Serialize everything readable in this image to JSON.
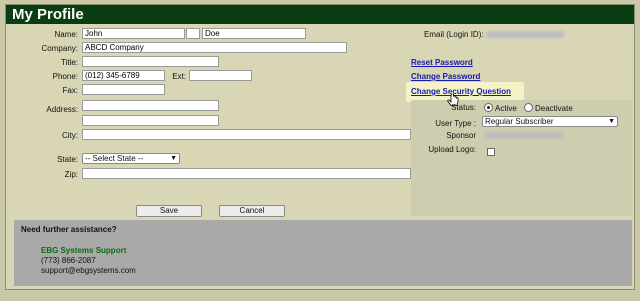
{
  "page": {
    "title": "My Profile"
  },
  "form": {
    "name_label": "Name:",
    "first_name": "John",
    "last_name": "Doe",
    "company_label": "Company:",
    "company": "ABCD Company",
    "title_label": "Title:",
    "title_value": "",
    "phone_label": "Phone:",
    "phone": "(012) 345-6789",
    "ext_label": "Ext:",
    "ext": "",
    "fax_label": "Fax:",
    "fax": "",
    "address_label": "Address:",
    "address1": "",
    "address2": "",
    "city_label": "City:",
    "city": "",
    "state_label": "State:",
    "state_selected": "-- Select State --",
    "zip_label": "Zip:",
    "zip": "",
    "email_label": "Email (Login ID):",
    "save_label": "Save",
    "cancel_label": "Cancel"
  },
  "links": {
    "reset_password": "Reset Password",
    "change_password": "Change Password",
    "change_security_question": "Change Security Question"
  },
  "account": {
    "status_label": "Status:",
    "status_active": "Active",
    "status_deactivate": "Deactivate",
    "status_selected": "Active",
    "user_type_label": "User Type :",
    "user_type_selected": "Regular Subscriber",
    "sponsor_label": "Sponsor",
    "upload_logo_label": "Upload Logo:",
    "upload_logo_checked": false
  },
  "support": {
    "heading": "Need further assistance?",
    "name": "EBG Systems Support",
    "phone": "(773) 866-2087",
    "email": "support@ebgsystems.com"
  },
  "colors": {
    "title_bar": "#0b3d12",
    "link": "#1a1aa8",
    "support_name": "#0d6b12"
  }
}
